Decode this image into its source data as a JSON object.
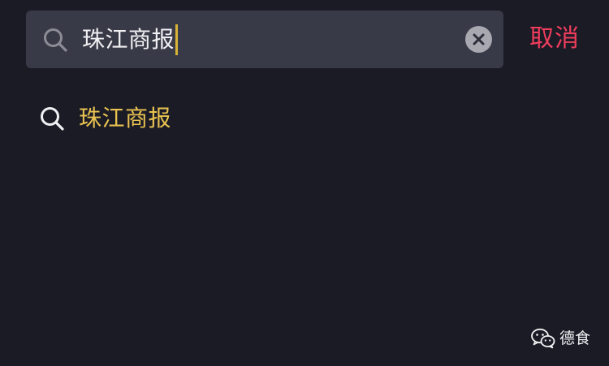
{
  "search": {
    "query": "珠江商报",
    "icon": "search-icon",
    "clear_icon": "clear-icon"
  },
  "cancel_label": "取消",
  "suggestions": [
    {
      "text": "珠江商报",
      "icon": "search-icon"
    }
  ],
  "watermark": {
    "icon": "wechat-icon",
    "text": "德食"
  },
  "colors": {
    "background": "#1b1b26",
    "search_bar": "#393a47",
    "cancel": "#ee3d5c",
    "suggestion_text": "#e9c350",
    "caret": "#d8b435"
  }
}
